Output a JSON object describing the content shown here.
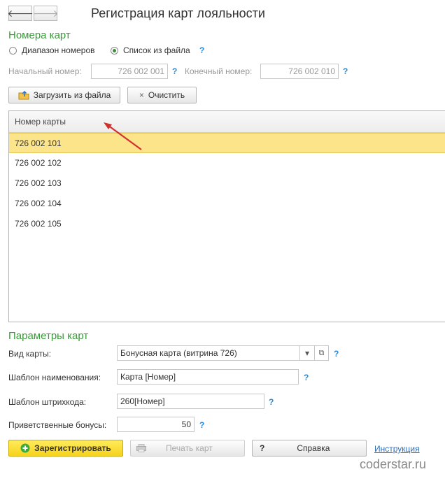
{
  "nav": {
    "back_icon": "arrow-left-icon",
    "forward_icon": "arrow-right-icon",
    "back_glyph": "🡐",
    "forward_glyph": "🡒"
  },
  "title": "Регистрация карт лояльности",
  "card_numbers": {
    "section_title": "Номера карт",
    "radio_range": "Диапазон номеров",
    "radio_list": "Список из файла",
    "selected_mode": "Список из файла",
    "help": "?",
    "start_label": "Начальный номер:",
    "start_value": "726 002 001",
    "end_label": "Конечный номер:",
    "end_value": "726 002 010"
  },
  "toolbar": {
    "load_label": "Загрузить из файла",
    "clear_glyph": "×",
    "clear_label": "Очистить"
  },
  "table": {
    "column_header": "Номер карты",
    "rows": [
      "726 002 101",
      "726 002 102",
      "726 002 103",
      "726 002 104",
      "726 002 105"
    ],
    "selected_index": 0
  },
  "params": {
    "section_title": "Параметры карт",
    "help": "?",
    "card_type_label": "Вид карты:",
    "card_type_value": "Бонусная карта (витрина 726)",
    "dropdown_glyph": "▾",
    "open_glyph": "⧉",
    "name_template_label": "Шаблон наименования:",
    "name_template_value": "Карта [Номер]",
    "barcode_template_label": "Шаблон штрихкода:",
    "barcode_template_value": "260[Номер]",
    "welcome_bonus_label": "Приветственные бонусы:",
    "welcome_bonus_value": "50"
  },
  "footer": {
    "register_label": "Зарегистрировать",
    "print_label": "Печать карт",
    "help_glyph": "?",
    "help_label": "Справка",
    "instruction_link": "Инструкция"
  },
  "watermark": "coderstar.ru",
  "colors": {
    "accent_green": "#3a9a3a",
    "selection": "#fbe48a",
    "primary_button": "#f6d21b",
    "help": "#2d8ad6",
    "arrow": "#d0312d"
  }
}
